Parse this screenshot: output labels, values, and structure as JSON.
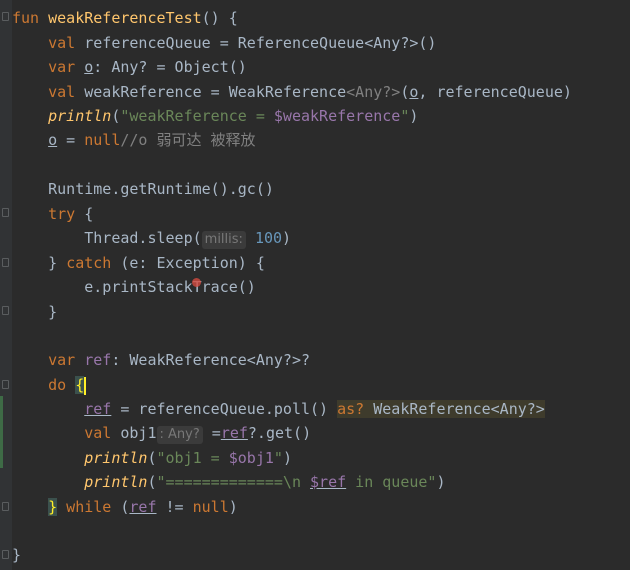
{
  "editor": {
    "lines": {
      "l1": {
        "kw": "fun ",
        "fn": "weakReferenceTest",
        "rest": "() {"
      },
      "l2": {
        "kw": "val ",
        "rest": "referenceQueue = ReferenceQueue<Any?>()"
      },
      "l3": {
        "kw": "var ",
        "var": "o",
        "rest": ": Any? = Object()"
      },
      "l4": {
        "kw": "val ",
        "a": "weakReference = WeakReference",
        "gen": "<Any?>",
        "b": "(",
        "o": "o",
        ", ": ", ",
        "c": "referenceQueue)"
      },
      "l5": {
        "fn": "println",
        "a": "(",
        "s1": "\"weakReference = ",
        "tmpl": "$weakReference",
        "s2": "\"",
        "b": ")"
      },
      "l6": {
        "var": "o",
        "a": " = ",
        "null": "null",
        "cmt": "//o 弱可达 被释放"
      },
      "l8": {
        "text": "Runtime.getRuntime().gc()"
      },
      "l9": {
        "kw": "try ",
        "rest": "{"
      },
      "l10": {
        "a": "Thread.sleep(",
        "hint": "millis:",
        "num": " 100",
        ")": ")"
      },
      "l11": {
        "a": "} ",
        "kw": "catch ",
        "rest": "(e: Exception) {"
      },
      "l12": {
        "text": "e.printStackTrace()"
      },
      "l13": {
        "text": "}"
      },
      "l15": {
        "kw": "var ",
        "var": "ref",
        ": ": ": WeakReference<Any?>?"
      },
      "l16": {
        "kw": "do ",
        "brace": "{"
      },
      "l17": {
        "var": "ref",
        "a": " = referenceQueue.poll() ",
        "kw": "as? ",
        "b": "WeakReference<Any?>"
      },
      "l18": {
        "kw": "val ",
        "a": "obj1",
        "hint": ": Any?",
        "b": " =",
        "var": "ref",
        "c": "?.get()"
      },
      "l19": {
        "fn": "println",
        "a": "(",
        "s1": "\"obj1 = ",
        "tmpl": "$obj1",
        "s2": "\"",
        "b": ")"
      },
      "l20": {
        "fn": "println",
        "a": "(",
        "s1": "\"=============\\n ",
        "tmpl": "$ref",
        "s2": " in queue\"",
        "b": ")"
      },
      "l21": {
        "brace": "}",
        "kw": " while ",
        "a": "(",
        "var": "ref",
        "b": " != ",
        "null": "null",
        ")": ")"
      },
      "l23": {
        "text": "}"
      }
    }
  },
  "colors": {
    "background": "#2b2b2b",
    "keyword": "#cc7832",
    "function": "#ffc66d",
    "string": "#6a8759",
    "variable": "#9876aa",
    "number": "#6897bb",
    "comment": "#808080"
  }
}
